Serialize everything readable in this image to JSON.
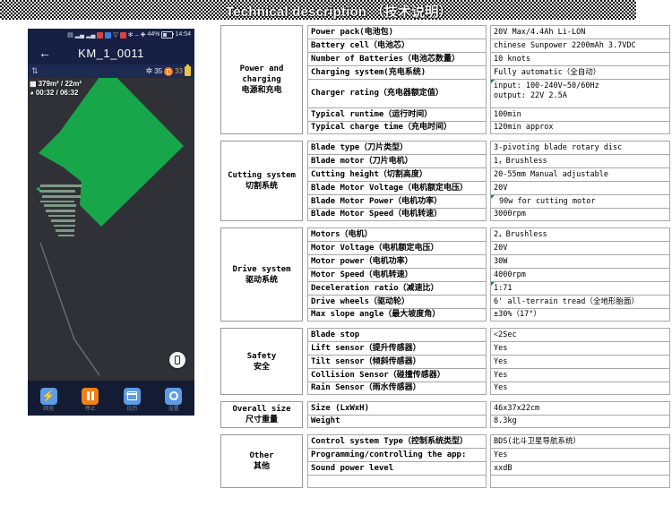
{
  "banner": {
    "title": "Technical description （技术说明）"
  },
  "phone": {
    "statusbar": {
      "battery_percent": "44%",
      "time": "14:54",
      "icons": [
        "sim-signal-icon",
        "signal-bars-icon",
        "signal-bars-2-icon",
        "app-red-icon",
        "app-blue-icon",
        "shield-icon",
        "app-red-2-icon",
        "settings-dot-icon",
        "minus-icon",
        "bluetooth-icon"
      ]
    },
    "titlebar": {
      "back_label": "←",
      "title": "KM_1_0011"
    },
    "infobar": {
      "bluetooth_icon": "bluetooth-icon",
      "satellite_count": "35",
      "signal_value": "33"
    },
    "map_overlay": {
      "area_line": "379m² / 22m²",
      "time_line": "00:32 / 06:32"
    },
    "toolbar": [
      {
        "icon": "lightning-icon",
        "label": "回充",
        "glyph": "⚡"
      },
      {
        "icon": "pause-icon",
        "label": "停止",
        "glyph": ""
      },
      {
        "icon": "calendar-icon",
        "label": "日历",
        "glyph": ""
      },
      {
        "icon": "gear-icon",
        "label": "设置",
        "glyph": ""
      }
    ],
    "locate_button": "locate-button"
  },
  "spec_groups": [
    {
      "name_en": "Power and charging",
      "name_cn": "电源和充电",
      "rows": [
        {
          "label": "Power pack(电池包)",
          "value": "20V Max/4.4Ah Li-LON"
        },
        {
          "label": "Battery cell（电池芯）",
          "value": "chinese Sunpower 2200mAh 3.7VDC"
        },
        {
          "label": "Number of Batteries（电池芯数量）",
          "value": "10 knots"
        },
        {
          "label": "Charging system(充电系统)",
          "value": "Fully automatic（全自动）"
        },
        {
          "label": "Charger rating（充电器额定值）",
          "value": "input: 100-240V~50/60Hz",
          "value2": "output: 22V 2.5A",
          "tall": true,
          "mark": true
        },
        {
          "label": "Typical runtime（运行时间）",
          "value": "100min"
        },
        {
          "label": "Typical charge time（充电时间）",
          "value": "120min approx"
        }
      ]
    },
    {
      "name_en": "Cutting system",
      "name_cn": "切割系统",
      "rows": [
        {
          "label": "Blade type（刀片类型）",
          "value": "3-pivoting blade rotary disc"
        },
        {
          "label": "Blade motor（刀片电机）",
          "value": "1，Brushless"
        },
        {
          "label": "Cutting height（切割高度）",
          "value": "20-55mm Manual adjustable"
        },
        {
          "label": "Blade Motor Voltage（电机额定电压）",
          "value": "20V"
        },
        {
          "label": "Blade Motor Power（电机功率）",
          "value": "90w for cutting motor",
          "indent": true,
          "mark": true
        },
        {
          "label": "Blade Motor Speed（电机转速）",
          "value": "3000rpm"
        }
      ]
    },
    {
      "name_en": "Drive system",
      "name_cn": "驱动系统",
      "rows": [
        {
          "label": "Motors（电机）",
          "value": "2，Brushless"
        },
        {
          "label": "Motor Voltage（电机额定电压）",
          "value": "20V"
        },
        {
          "label": "Motor power（电机功率）",
          "value": "30W"
        },
        {
          "label": "Motor Speed（电机转速）",
          "value": "4000rpm"
        },
        {
          "label": "Deceleration ratio（减速比）",
          "value": "1:71",
          "mark": true
        },
        {
          "label": "Drive wheels（驱动轮）",
          "value": "6' all-terrain tread（全地形胎面）"
        },
        {
          "label": "Max slope angle（最大坡度角）",
          "value": "±30%（17°）"
        }
      ]
    },
    {
      "name_en": "Safety",
      "name_cn": "安全",
      "rows": [
        {
          "label": "Blade stop",
          "value": "˂2Sec"
        },
        {
          "label": "Lift sensor（提升传感器）",
          "value": "Yes"
        },
        {
          "label": "Tilt sensor（倾斜传感器）",
          "value": "Yes"
        },
        {
          "label": "Collision Sensor（碰撞传感器）",
          "value": "Yes"
        },
        {
          "label": "Rain Sensor（雨水传感器）",
          "value": "Yes"
        }
      ]
    },
    {
      "name_en": "Overall size",
      "name_cn": "尺寸重量",
      "rows": [
        {
          "label": "Size (LxWxH)",
          "value": "46x37x22cm"
        },
        {
          "label": "Weight",
          "value": "8.3kg"
        }
      ]
    },
    {
      "name_en": "Other",
      "name_cn": "其他",
      "rows": [
        {
          "label": "Control system Type（控制系统类型）",
          "value": "BDS(北斗卫星导航系统）"
        },
        {
          "label": "Programming/controlling the app:",
          "value": "Yes"
        },
        {
          "label": "Sound power level",
          "value": "xxdB"
        },
        {
          "label": "",
          "value": "",
          "empty": true
        }
      ]
    }
  ]
}
